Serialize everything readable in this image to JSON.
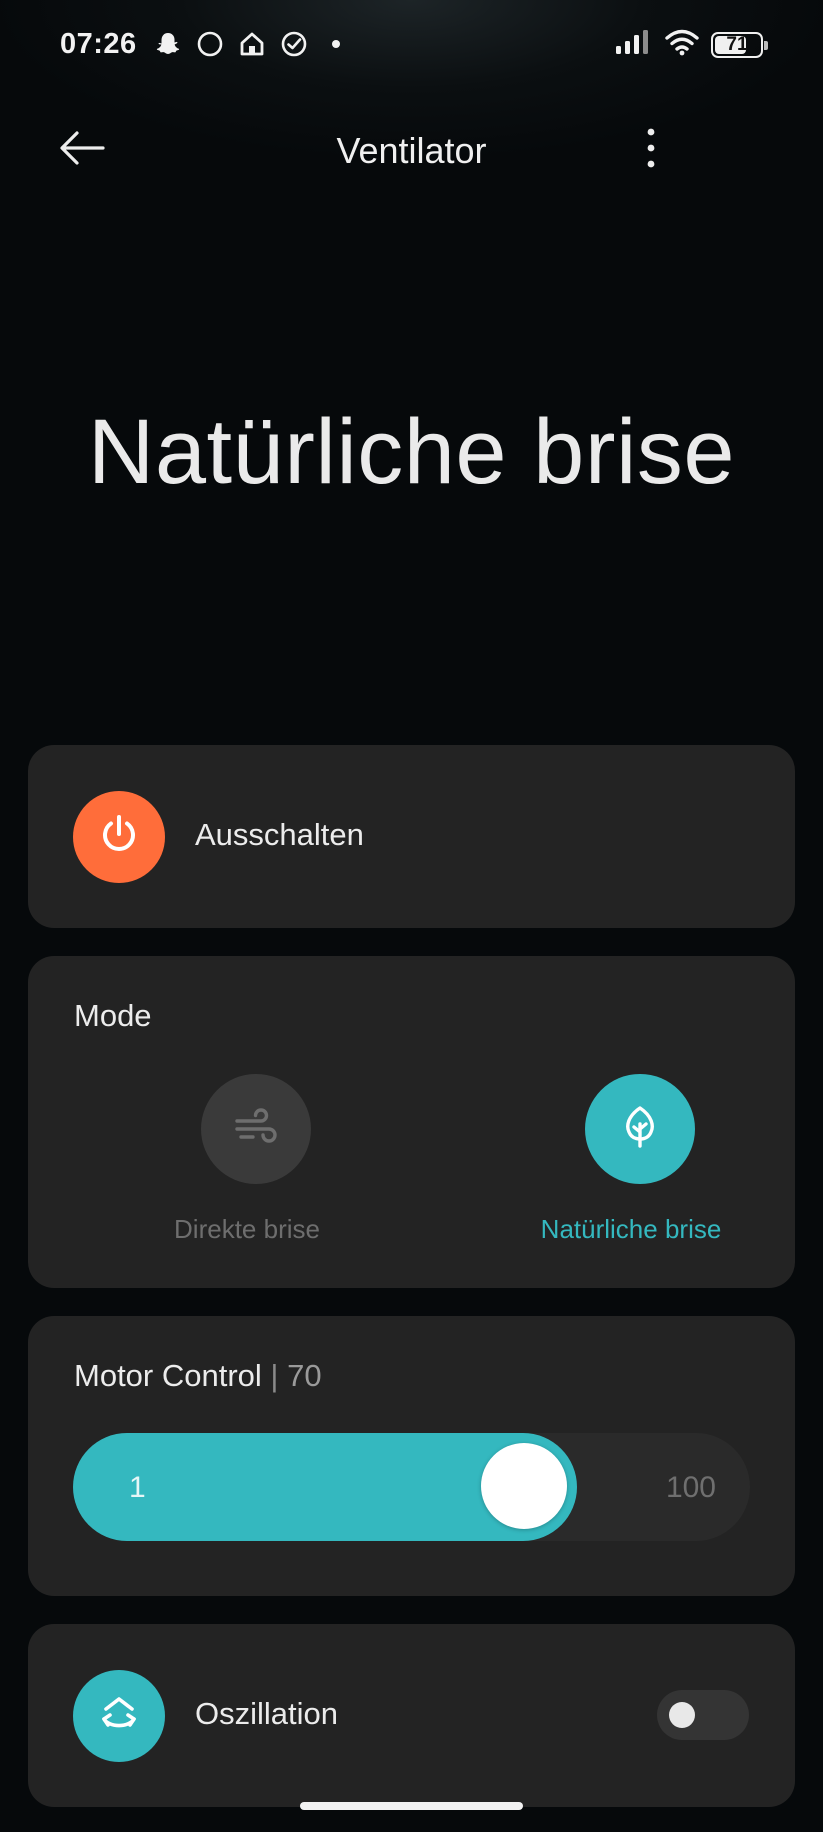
{
  "status_bar": {
    "time": "07:26",
    "battery_level": "71",
    "battery_fraction": 0.71,
    "left_icons": [
      "snapchat-icon",
      "circle-icon",
      "home-icon",
      "check-circle-icon",
      "dot-icon"
    ],
    "right_icons": [
      "signal-icon",
      "wifi-icon",
      "battery-icon"
    ]
  },
  "app_bar": {
    "title": "Ventilator",
    "back_icon": "arrow-left-icon",
    "more_icon": "more-vertical-icon"
  },
  "hero": {
    "title": "Natürliche brise"
  },
  "power": {
    "label": "Ausschalten",
    "icon": "power-icon",
    "color": "#ff6d3a"
  },
  "mode": {
    "heading": "Mode",
    "options": [
      {
        "label": "Direkte brise",
        "icon": "wind-icon",
        "selected": false
      },
      {
        "label": "Natürliche brise",
        "icon": "leaf-icon",
        "selected": true
      }
    ],
    "active_color": "#34b8bf",
    "inactive_color": "#3a3a3a"
  },
  "motor": {
    "heading": "Motor Control",
    "separator": "|",
    "value": "70",
    "min_label": "1",
    "max_label": "100",
    "min": 1,
    "max": 100,
    "current": 70,
    "color": "#34b8bf"
  },
  "oscillation": {
    "label": "Oszillation",
    "icon": "oscillate-icon",
    "enabled": false,
    "color": "#34b8bf"
  }
}
